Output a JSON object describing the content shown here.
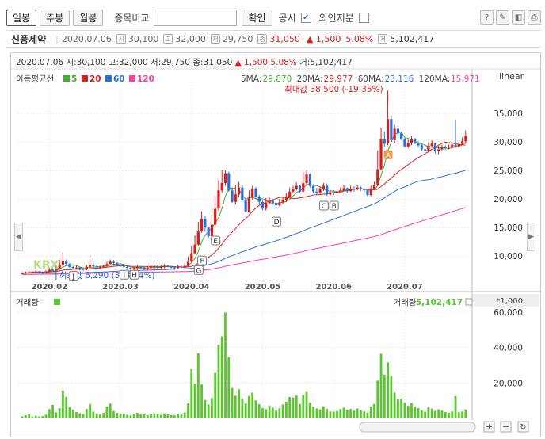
{
  "toolbar": {
    "tabs": [
      "일봉",
      "주봉",
      "월봉"
    ],
    "compare_label": "종목비교",
    "confirm_label": "확인",
    "disclosure_label": "공시",
    "foreign_label": "외인지분"
  },
  "stock": {
    "name": "신풍제약",
    "date": "2020.07.06",
    "open": "30,100",
    "high": "32,000",
    "low": "29,750",
    "close": "31,050",
    "change": "▲ 1,500",
    "change_pct": "5.08%",
    "volume": "5,102,417"
  },
  "price_info": {
    "date": "2020.07.06",
    "open_label": "시:",
    "open": "30,100",
    "high_label": "고:",
    "high": "32,000",
    "low_label": "저:",
    "low": "29,750",
    "close_label": "종:",
    "close": "31,050",
    "arrow": "▲",
    "change": "1,500",
    "change_pct": "5.08%",
    "volume_label": "거:",
    "volume": "5,102,417"
  },
  "ma_legend": {
    "title": "이동평균선",
    "items": [
      {
        "label": "5",
        "color": "#3dae2b"
      },
      {
        "label": "20",
        "color": "#e02020"
      },
      {
        "label": "60",
        "color": "#2a6fdb"
      },
      {
        "label": "120",
        "color": "#ff3fa0"
      }
    ],
    "values": [
      {
        "label": "5MA:",
        "value": "29,870",
        "color": "#3dae2b"
      },
      {
        "label": "20MA:",
        "value": "29,977",
        "color": "#e02020"
      },
      {
        "label": "60MA:",
        "value": "23,116",
        "color": "#2a6fdb"
      },
      {
        "label": "120MA:",
        "value": "15,971",
        "color": "#ff3fa0"
      }
    ],
    "scale": "linear"
  },
  "annotations": {
    "max": "최대값 38,500 (-19.35%)",
    "min": "최소값 6,290 (393.64%)",
    "markers": [
      "A",
      "B",
      "C",
      "D",
      "E",
      "F",
      "G",
      "H",
      "I",
      "J"
    ],
    "watermark": "KRX"
  },
  "volume_panel": {
    "title": "거래량",
    "value_label": "거래량:",
    "value": "5,102,417",
    "unit": "*1,000",
    "color": "#5ac82c"
  },
  "chart_data": {
    "type": "candlestick",
    "title": "",
    "x_tick_labels": [
      "2020.02",
      "2020.03",
      "2020.04",
      "2020.05",
      "2020.06",
      "2020.07"
    ],
    "price_axis_labels": [
      "35,000",
      "30,000",
      "25,000",
      "20,000",
      "15,000",
      "10,000"
    ],
    "price_axis_values": [
      35000,
      30000,
      25000,
      20000,
      15000,
      10000
    ],
    "price_ylim": [
      6000,
      40000
    ],
    "volume_axis_labels": [
      "60,000",
      "40,000",
      "20,000"
    ],
    "volume_axis_values": [
      60000,
      40000,
      20000
    ],
    "volume_ylim": [
      0,
      64000
    ],
    "close": [
      7000,
      7100,
      7200,
      7250,
      7300,
      7200,
      7100,
      7300,
      7600,
      7400,
      7800,
      8500,
      9200,
      8600,
      8100,
      7900,
      8000,
      7800,
      7700,
      8100,
      8500,
      8200,
      8000,
      8100,
      8300,
      8600,
      9000,
      8800,
      8500,
      8300,
      8100,
      7900,
      7700,
      7900,
      8100,
      8000,
      7800,
      7900,
      8100,
      8200,
      8000,
      8100,
      8300,
      8200,
      8000,
      7900,
      8200,
      8100,
      8300,
      9000,
      10500,
      12000,
      14300,
      16500,
      15000,
      13500,
      15500,
      18300,
      21500,
      22800,
      24500,
      21500,
      19500,
      20800,
      22000,
      19800,
      17800,
      20300,
      21800,
      20300,
      19500,
      18300,
      19300,
      19700,
      19300,
      18900,
      19400,
      19800,
      20300,
      21300,
      21800,
      22300,
      21300,
      22800,
      24300,
      22300,
      21300,
      21000,
      21700,
      22300,
      20800,
      21200,
      21000,
      21200,
      21500,
      21900,
      21400,
      21800,
      21700,
      22000,
      21800,
      21500,
      20700,
      21800,
      22500,
      25200,
      30500,
      29700,
      34000,
      30300,
      32300,
      31500,
      30500,
      29200,
      29800,
      30500,
      29900,
      29400,
      28700,
      28500,
      29300,
      29700,
      28400,
      28700,
      29000,
      28900,
      29000,
      29500,
      29200,
      29600,
      30100,
      31050
    ],
    "open": [
      6900,
      7000,
      7100,
      7200,
      7250,
      7300,
      7200,
      7100,
      7300,
      7600,
      7400,
      7800,
      8500,
      9200,
      8600,
      8100,
      7900,
      8000,
      7800,
      7700,
      8100,
      8500,
      8200,
      8000,
      8100,
      8300,
      8600,
      9000,
      8800,
      8500,
      8300,
      8100,
      7900,
      7700,
      7900,
      8100,
      8000,
      7800,
      7900,
      8100,
      8200,
      8000,
      8100,
      8300,
      8200,
      8000,
      7900,
      8200,
      8100,
      8300,
      9000,
      10500,
      12000,
      14300,
      16500,
      15000,
      13500,
      15500,
      18300,
      21500,
      22800,
      24500,
      21500,
      19500,
      20800,
      22000,
      19800,
      17800,
      20300,
      21800,
      20300,
      19500,
      18300,
      19300,
      19700,
      19300,
      18900,
      19400,
      19800,
      20300,
      21300,
      21800,
      22300,
      21300,
      22800,
      24300,
      22300,
      21300,
      21000,
      21700,
      22300,
      20800,
      21200,
      21000,
      21200,
      21500,
      21900,
      21400,
      21800,
      21700,
      22000,
      21800,
      21500,
      20700,
      21800,
      22500,
      25200,
      30500,
      29700,
      34000,
      30300,
      32300,
      31500,
      30500,
      29200,
      29800,
      30500,
      29900,
      29400,
      28700,
      28500,
      29300,
      29700,
      28400,
      28700,
      29000,
      28900,
      29000,
      29500,
      29200,
      29600,
      30100
    ],
    "high": [
      7200,
      7300,
      7400,
      7400,
      7500,
      7400,
      7300,
      7500,
      7900,
      7700,
      8400,
      9400,
      10600,
      9400,
      8800,
      8300,
      8300,
      8100,
      8000,
      8400,
      9500,
      8700,
      8400,
      8300,
      8500,
      9000,
      9400,
      9300,
      8900,
      8700,
      8500,
      8300,
      8000,
      8100,
      8400,
      8300,
      8100,
      8200,
      8400,
      8500,
      8400,
      8400,
      8600,
      8500,
      8300,
      8200,
      8500,
      8400,
      8700,
      9900,
      11800,
      13600,
      16000,
      17800,
      17000,
      15200,
      17200,
      20500,
      23300,
      25000,
      25000,
      24800,
      21900,
      22500,
      23000,
      22400,
      20100,
      21500,
      22300,
      22100,
      20700,
      19700,
      20200,
      20400,
      20000,
      19500,
      20000,
      20400,
      21000,
      22000,
      22300,
      22900,
      22500,
      24800,
      25000,
      24500,
      22600,
      21900,
      22200,
      22800,
      22700,
      21600,
      21500,
      21600,
      22000,
      22400,
      22000,
      22300,
      22200,
      22400,
      22200,
      21900,
      21300,
      22300,
      23000,
      28500,
      32500,
      31800,
      38500,
      34500,
      33000,
      32800,
      31800,
      30700,
      30400,
      31000,
      30700,
      30100,
      29700,
      29100,
      29900,
      30300,
      29800,
      29300,
      29500,
      29400,
      29500,
      30000,
      33800,
      30000,
      30800,
      32000
    ],
    "low": [
      6800,
      6900,
      7000,
      7100,
      7100,
      7000,
      6900,
      7000,
      7200,
      7200,
      7200,
      7600,
      8200,
      8300,
      7900,
      7600,
      7700,
      7500,
      7400,
      7500,
      7900,
      8000,
      7800,
      7700,
      7900,
      8100,
      8400,
      8500,
      8300,
      8100,
      7900,
      7600,
      7300,
      7400,
      7600,
      7700,
      7500,
      7500,
      7600,
      7800,
      7800,
      7800,
      7900,
      8000,
      7800,
      7600,
      7700,
      7900,
      7900,
      8100,
      8800,
      10300,
      11800,
      14100,
      14300,
      13200,
      13300,
      15200,
      17900,
      21100,
      22300,
      21300,
      19300,
      19000,
      20300,
      19600,
      17600,
      17600,
      19900,
      20000,
      19000,
      18000,
      18000,
      19000,
      19000,
      18600,
      18700,
      19100,
      19500,
      20100,
      21000,
      21500,
      21100,
      21200,
      22500,
      22000,
      21000,
      20700,
      20700,
      21400,
      20500,
      20600,
      20700,
      20900,
      21000,
      21400,
      21100,
      21200,
      21300,
      21500,
      21400,
      21200,
      20500,
      20500,
      21500,
      22300,
      25000,
      29200,
      29400,
      30000,
      29800,
      30000,
      30300,
      29000,
      28900,
      29400,
      29600,
      29000,
      28400,
      28200,
      28300,
      29000,
      28000,
      27800,
      28500,
      28600,
      28700,
      28800,
      28900,
      29000,
      29400,
      29750
    ],
    "volume": [
      1200,
      1800,
      2500,
      900,
      1500,
      1100,
      1300,
      2100,
      5200,
      7600,
      3400,
      5800,
      15600,
      12200,
      6300,
      4900,
      3600,
      2900,
      2400,
      5300,
      8200,
      3800,
      2700,
      2200,
      3100,
      6700,
      8400,
      4200,
      3100,
      2600,
      2500,
      2000,
      1700,
      2400,
      3100,
      2800,
      2200,
      1900,
      2300,
      2900,
      2600,
      2000,
      2800,
      2300,
      1900,
      1700,
      2600,
      2100,
      3400,
      8500,
      27800,
      19600,
      36800,
      19200,
      10500,
      7900,
      11400,
      25700,
      41500,
      46300,
      59800,
      34600,
      17200,
      12800,
      16400,
      11200,
      8400,
      12700,
      14600,
      10200,
      8100,
      5900,
      5200,
      7300,
      6100,
      4600,
      5700,
      7900,
      9400,
      12100,
      11800,
      12900,
      8200,
      13200,
      14900,
      8900,
      6700,
      5600,
      5100,
      6800,
      5400,
      4000,
      3800,
      4200,
      5200,
      6100,
      4900,
      5300,
      4400,
      5600,
      4700,
      3900,
      3300,
      6800,
      8200,
      21300,
      36500,
      24700,
      31600,
      23900,
      14600,
      10700,
      11200,
      8800,
      7100,
      8700,
      6800,
      5800,
      4600,
      3800,
      6300,
      5500,
      4300,
      5100,
      4400,
      3600,
      3200,
      3900,
      12600,
      3500,
      3900,
      5100
    ],
    "series": [
      {
        "name": "5",
        "period": 5
      },
      {
        "name": "20",
        "period": 20
      },
      {
        "name": "60",
        "period": 60
      },
      {
        "name": "120",
        "period": 120
      }
    ]
  }
}
